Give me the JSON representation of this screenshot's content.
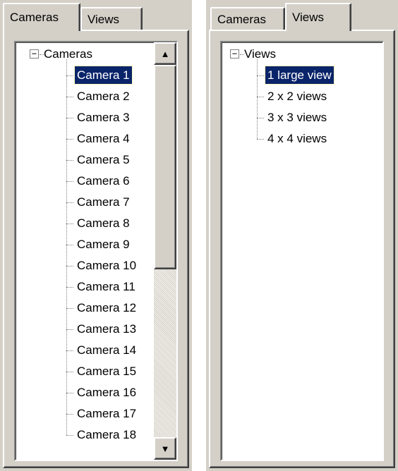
{
  "left_panel": {
    "tabs": [
      {
        "label": "Cameras",
        "active": true
      },
      {
        "label": "Views",
        "active": false
      }
    ],
    "tree": {
      "root_label": "Cameras",
      "expander": "−",
      "items": [
        "Camera 1",
        "Camera 2",
        "Camera 3",
        "Camera 4",
        "Camera 5",
        "Camera 6",
        "Camera 7",
        "Camera 8",
        "Camera 9",
        "Camera 10",
        "Camera 11",
        "Camera 12",
        "Camera 13",
        "Camera 14",
        "Camera 15",
        "Camera 16",
        "Camera 17",
        "Camera 18"
      ],
      "selected_index": 0
    },
    "scrollbar": {
      "up_arrow": "▲",
      "down_arrow": "▼"
    }
  },
  "right_panel": {
    "tabs": [
      {
        "label": "Cameras",
        "active": false
      },
      {
        "label": "Views",
        "active": true
      }
    ],
    "tree": {
      "root_label": "Views",
      "expander": "−",
      "items": [
        "1 large view",
        "2 x 2 views",
        "3 x 3 views",
        "4 x 4 views"
      ],
      "selected_index": 0
    }
  },
  "colors": {
    "panel_bg": "#d4d0c8",
    "selection_bg": "#0a246a",
    "selection_fg": "#ffffff"
  }
}
